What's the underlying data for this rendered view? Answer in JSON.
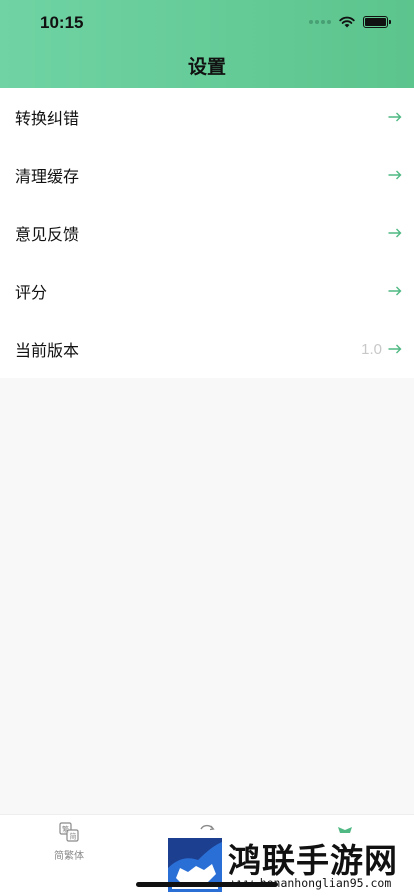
{
  "status_bar": {
    "time": "10:15"
  },
  "nav": {
    "title": "设置"
  },
  "settings": {
    "items": [
      {
        "label": "转换纠错",
        "value": ""
      },
      {
        "label": "清理缓存",
        "value": ""
      },
      {
        "label": "意见反馈",
        "value": ""
      },
      {
        "label": "评分",
        "value": ""
      },
      {
        "label": "当前版本",
        "value": "1.0"
      }
    ]
  },
  "tabbar": {
    "tabs": [
      {
        "label": "简繁体",
        "icon": "convert-icon",
        "active": false
      },
      {
        "label": "",
        "icon": "translate-icon",
        "active": false
      },
      {
        "label": "",
        "icon": "settings-icon",
        "active": true
      }
    ]
  },
  "watermark": {
    "title": "鸿联手游网",
    "url": "www.henanhonglian95.com"
  },
  "colors": {
    "header_start": "#6fd3a3",
    "header_end": "#5cc48d",
    "arrow": "#4fb883",
    "value_text": "#c8c8c8",
    "tab_inactive": "#8a8a8a"
  }
}
